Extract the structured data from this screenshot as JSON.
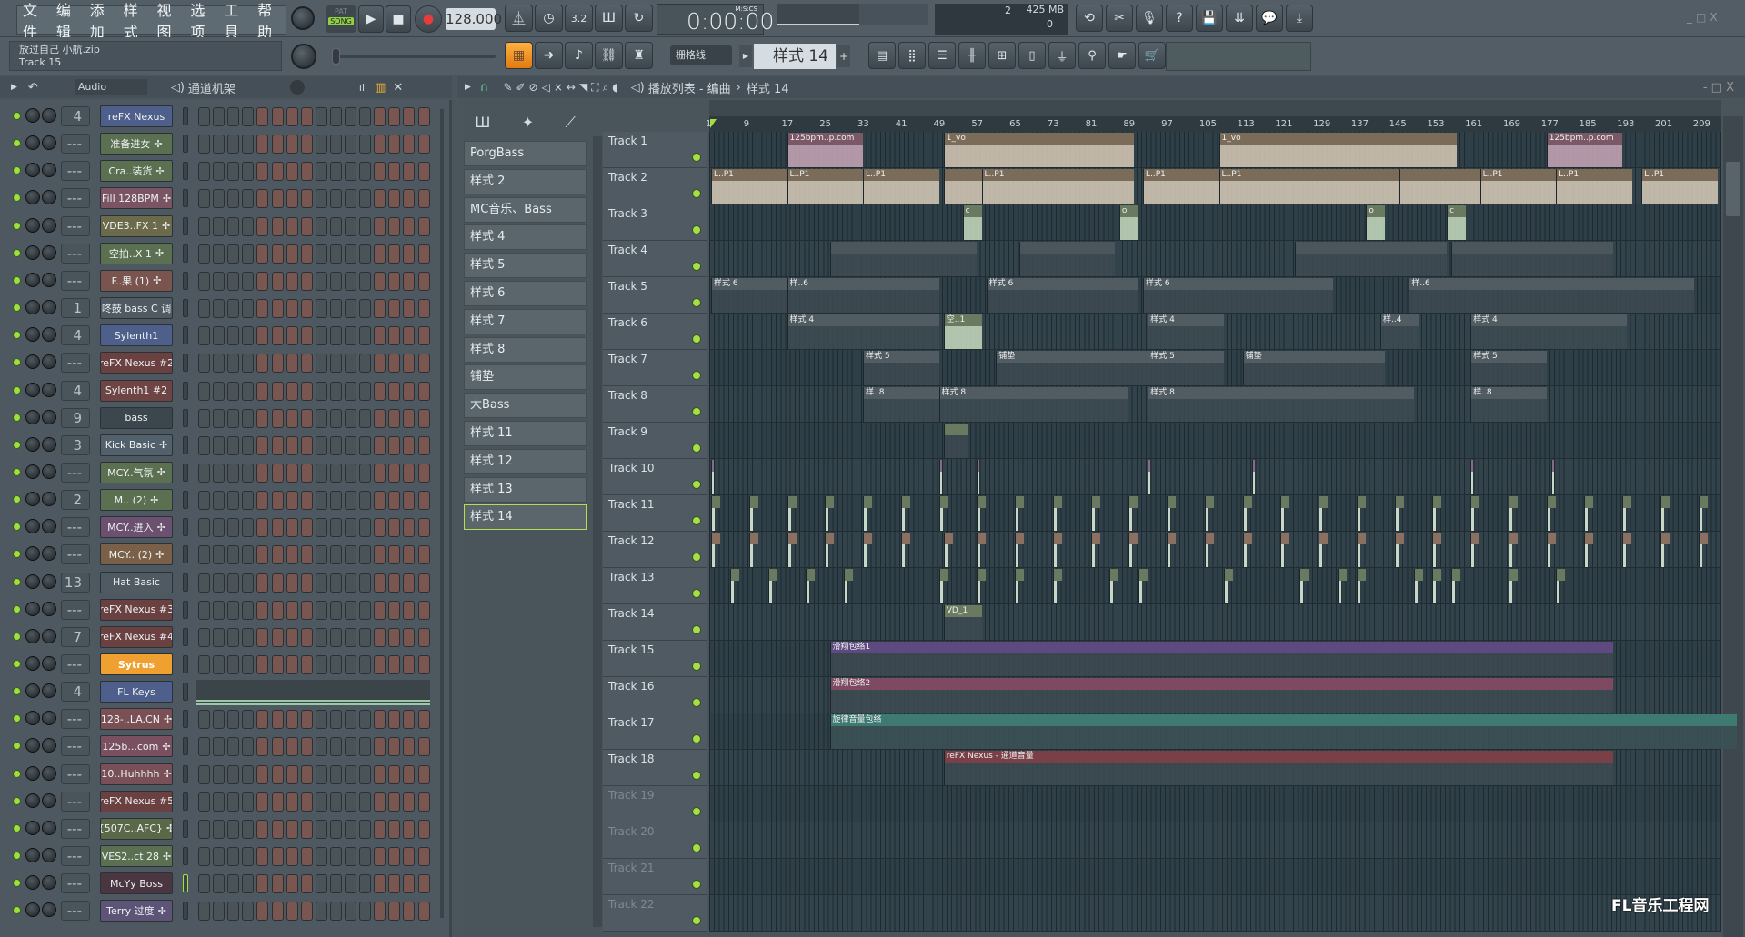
{
  "menu": [
    "文件",
    "编辑",
    "添加",
    "样式",
    "视图",
    "选项",
    "工具",
    "帮助"
  ],
  "transport": {
    "pat": "PAT",
    "song": "SONG",
    "tempo": "128.000",
    "time": "0:00:00",
    "time_label": "M:S:CS",
    "cpu": "2",
    "memory": "425 MB",
    "poly": "0"
  },
  "hint": {
    "line1": "放过自己 小航.zip",
    "line2": "Track 15"
  },
  "snap": "栅格线",
  "pattern_selector": "样式 14",
  "pattern_add": "+",
  "channel_rack": {
    "title": "通道机架",
    "group": "Audio",
    "step_pattern": [
      0,
      0,
      0,
      0,
      1,
      1,
      1,
      1,
      0,
      0,
      0,
      0,
      1,
      1,
      1,
      1
    ],
    "channels": [
      {
        "name": "reFX Nexus",
        "num": "4",
        "color": "#4d5f8a",
        "wave": false
      },
      {
        "name": "准备进女",
        "num": "---",
        "color": "#5b7050",
        "wave": true
      },
      {
        "name": "Cra..装货",
        "num": "---",
        "color": "#5b7050",
        "wave": true
      },
      {
        "name": "Fill 128BPM",
        "num": "---",
        "color": "#7a5463",
        "wave": true
      },
      {
        "name": "VDE3..FX 1",
        "num": "---",
        "color": "#6b6a4a",
        "wave": true
      },
      {
        "name": "空拍..X 1",
        "num": "---",
        "color": "#5b7050",
        "wave": true
      },
      {
        "name": "F..果 (1)",
        "num": "---",
        "color": "#7a5550",
        "wave": true
      },
      {
        "name": "咚鼓 bass C 调",
        "num": "1",
        "color": "#4f5a62",
        "wave": false
      },
      {
        "name": "Sylenth1",
        "num": "4",
        "color": "#4d5f8a",
        "wave": false
      },
      {
        "name": "reFX Nexus #2",
        "num": "---",
        "color": "#6a4040",
        "wave": false
      },
      {
        "name": "Sylenth1 #2",
        "num": "4",
        "color": "#6e4444",
        "wave": false
      },
      {
        "name": "bass",
        "num": "9",
        "color": "#3c464d",
        "wave": false
      },
      {
        "name": "Kick Basic",
        "num": "3",
        "color": "#52606b",
        "wave": true
      },
      {
        "name": "MCY..气氛",
        "num": "---",
        "color": "#5b7050",
        "wave": true
      },
      {
        "name": "M.. (2)",
        "num": "2",
        "color": "#5b7050",
        "wave": true
      },
      {
        "name": "MCY..进入",
        "num": "---",
        "color": "#6b5070",
        "wave": true
      },
      {
        "name": "MCY.. (2)",
        "num": "---",
        "color": "#7a6048",
        "wave": true
      },
      {
        "name": "Hat Basic",
        "num": "13",
        "color": "#4f5a62",
        "wave": false
      },
      {
        "name": "reFX Nexus #3",
        "num": "---",
        "color": "#6a4040",
        "wave": false
      },
      {
        "name": "reFX Nexus #4",
        "num": "7",
        "color": "#6a4040",
        "wave": false
      },
      {
        "name": "Sytrus",
        "num": "---",
        "color": "#f0a030",
        "wave": false,
        "piano": false
      },
      {
        "name": "FL Keys",
        "num": "4",
        "color": "#4d5f8a",
        "wave": false,
        "piano": true
      },
      {
        "name": "128-..LA.CN",
        "num": "---",
        "color": "#7a5055",
        "wave": true
      },
      {
        "name": "125b...com",
        "num": "---",
        "color": "#7a5060",
        "wave": true
      },
      {
        "name": "10..Huhhhh",
        "num": "---",
        "color": "#7a5058",
        "wave": true
      },
      {
        "name": "reFX Nexus #5",
        "num": "---",
        "color": "#6a4040",
        "wave": false
      },
      {
        "name": "{507C..AFC}",
        "num": "---",
        "color": "#5a6848",
        "wave": true
      },
      {
        "name": "VES2..ct 28",
        "num": "---",
        "color": "#5a7050",
        "wave": true
      },
      {
        "name": "McYy Boss",
        "num": "---",
        "color": "#4a3640",
        "wave": false
      },
      {
        "name": "Terry 过度",
        "num": "---",
        "color": "#5e5478",
        "wave": true
      }
    ]
  },
  "playlist": {
    "title": "播放列表 - 编曲",
    "crumb": "样式 14",
    "patterns": [
      "PorgBass",
      "样式 2",
      "MC音乐、Bass",
      "样式 4",
      "样式 5",
      "样式 6",
      "样式 7",
      "样式 8",
      "铺垫",
      "大Bass",
      "样式 11",
      "样式 12",
      "样式 13",
      "样式 14"
    ],
    "selected_pattern": "样式 14",
    "ruler": [
      1,
      9,
      17,
      25,
      33,
      41,
      49,
      57,
      65,
      73,
      81,
      89,
      97,
      105,
      113,
      121,
      129,
      137,
      145,
      153,
      161,
      169,
      177,
      185,
      193,
      201,
      209
    ],
    "tracks": [
      "Track 1",
      "Track 2",
      "Track 3",
      "Track 4",
      "Track 5",
      "Track 6",
      "Track 7",
      "Track 8",
      "Track 9",
      "Track 10",
      "Track 11",
      "Track 12",
      "Track 13",
      "Track 14",
      "Track 15",
      "Track 16",
      "Track 17",
      "Track 18",
      "Track 19",
      "Track 20",
      "Track 21",
      "Track 22"
    ],
    "clips": [
      {
        "t": 1,
        "s": 17,
        "l": 16,
        "n": "125bpm..p.com",
        "c": "#7a5866",
        "b": "#c9a8b8"
      },
      {
        "t": 1,
        "s": 50,
        "l": 40,
        "n": "1_vo",
        "c": "#7a6c58",
        "b": "#d8cbb8"
      },
      {
        "t": 1,
        "s": 108,
        "l": 50,
        "n": "1_vo",
        "c": "#7a6c58",
        "b": "#d8cbb8"
      },
      {
        "t": 1,
        "s": 177,
        "l": 16,
        "n": "125bpm..p.com",
        "c": "#7a5866",
        "b": "#c9a8b8"
      },
      {
        "t": 2,
        "s": 1,
        "l": 16,
        "n": "L..P1",
        "c": "#7a6c58",
        "b": "#d8cbb8"
      },
      {
        "t": 2,
        "s": 17,
        "l": 16,
        "n": "L..P1",
        "c": "#7a6c58",
        "b": "#d8cbb8"
      },
      {
        "t": 2,
        "s": 33,
        "l": 16,
        "n": "L..P1",
        "c": "#7a6c58",
        "b": "#d8cbb8"
      },
      {
        "t": 2,
        "s": 50,
        "l": 8,
        "n": "",
        "c": "#7a6c58",
        "b": "#d8cbb8"
      },
      {
        "t": 2,
        "s": 58,
        "l": 32,
        "n": "L..P1",
        "c": "#7a6c58",
        "b": "#d8cbb8"
      },
      {
        "t": 2,
        "s": 92,
        "l": 16,
        "n": "L..P1",
        "c": "#7a6c58",
        "b": "#d8cbb8"
      },
      {
        "t": 2,
        "s": 108,
        "l": 38,
        "n": "L..P1",
        "c": "#7a6c58",
        "b": "#d8cbb8"
      },
      {
        "t": 2,
        "s": 146,
        "l": 17,
        "n": "",
        "c": "#7a6c58",
        "b": "#d8cbb8"
      },
      {
        "t": 2,
        "s": 163,
        "l": 16,
        "n": "L..P1",
        "c": "#7a6c58",
        "b": "#d8cbb8"
      },
      {
        "t": 2,
        "s": 179,
        "l": 16,
        "n": "L..P1",
        "c": "#7a6c58",
        "b": "#d8cbb8"
      },
      {
        "t": 2,
        "s": 197,
        "l": 16,
        "n": "L..P1",
        "c": "#7a6c58",
        "b": "#d8cbb8"
      },
      {
        "t": 3,
        "s": 54,
        "l": 4,
        "n": "c",
        "c": "#6a7a60",
        "b": "#c8dcc0"
      },
      {
        "t": 3,
        "s": 87,
        "l": 4,
        "n": "o",
        "c": "#6a7a60",
        "b": "#c8dcc0"
      },
      {
        "t": 3,
        "s": 139,
        "l": 4,
        "n": "o",
        "c": "#6a7a60",
        "b": "#c8dcc0"
      },
      {
        "t": 3,
        "s": 156,
        "l": 4,
        "n": "c",
        "c": "#6a7a60",
        "b": "#c8dcc0"
      },
      {
        "t": 4,
        "s": 26,
        "l": 31,
        "n": "",
        "c": "#4a555c",
        "b": "#3e4a52"
      },
      {
        "t": 4,
        "s": 66,
        "l": 20,
        "n": "",
        "c": "#4a555c",
        "b": "#3e4a52"
      },
      {
        "t": 4,
        "s": 124,
        "l": 32,
        "n": "",
        "c": "#4a555c",
        "b": "#3e4a52"
      },
      {
        "t": 4,
        "s": 157,
        "l": 34,
        "n": "",
        "c": "#4a555c",
        "b": "#3e4a52"
      },
      {
        "t": 5,
        "s": 1,
        "l": 16,
        "n": "样式 6",
        "c": "#505b62",
        "b": "#3d4a52"
      },
      {
        "t": 5,
        "s": 17,
        "l": 32,
        "n": "样..6",
        "c": "#505b62",
        "b": "#3d4a52"
      },
      {
        "t": 5,
        "s": 59,
        "l": 32,
        "n": "样式 6",
        "c": "#505b62",
        "b": "#3d4a52"
      },
      {
        "t": 5,
        "s": 92,
        "l": 40,
        "n": "样式 6",
        "c": "#505b62",
        "b": "#3d4a52"
      },
      {
        "t": 5,
        "s": 148,
        "l": 60,
        "n": "样..6",
        "c": "#505b62",
        "b": "#3d4a52"
      },
      {
        "t": 6,
        "s": 17,
        "l": 32,
        "n": "样式 4",
        "c": "#505b62",
        "b": "#3d4a52"
      },
      {
        "t": 6,
        "s": 50,
        "l": 8,
        "n": "空..1",
        "c": "#6a7a60",
        "b": "#c8dcc0"
      },
      {
        "t": 6,
        "s": 93,
        "l": 16,
        "n": "样式 4",
        "c": "#505b62",
        "b": "#3d4a52"
      },
      {
        "t": 6,
        "s": 142,
        "l": 8,
        "n": "样..4",
        "c": "#505b62",
        "b": "#3d4a52"
      },
      {
        "t": 6,
        "s": 161,
        "l": 33,
        "n": "样式 4",
        "c": "#505b62",
        "b": "#3d4a52"
      },
      {
        "t": 7,
        "s": 33,
        "l": 16,
        "n": "样式 5",
        "c": "#505b62",
        "b": "#3d4a52"
      },
      {
        "t": 7,
        "s": 61,
        "l": 32,
        "n": "铺垫",
        "c": "#505b62",
        "b": "#3d4a52"
      },
      {
        "t": 7,
        "s": 93,
        "l": 16,
        "n": "样式 5",
        "c": "#505b62",
        "b": "#3d4a52"
      },
      {
        "t": 7,
        "s": 113,
        "l": 30,
        "n": "铺垫",
        "c": "#505b62",
        "b": "#3d4a52"
      },
      {
        "t": 7,
        "s": 161,
        "l": 16,
        "n": "样式 5",
        "c": "#505b62",
        "b": "#3d4a52"
      },
      {
        "t": 8,
        "s": 33,
        "l": 16,
        "n": "样..8",
        "c": "#505b62",
        "b": "#3d4a52"
      },
      {
        "t": 8,
        "s": 49,
        "l": 40,
        "n": "样式 8",
        "c": "#505b62",
        "b": "#3d4a52"
      },
      {
        "t": 8,
        "s": 93,
        "l": 56,
        "n": "样式 8",
        "c": "#505b62",
        "b": "#3d4a52"
      },
      {
        "t": 8,
        "s": 161,
        "l": 16,
        "n": "样..8",
        "c": "#505b62",
        "b": "#3d4a52"
      },
      {
        "t": 9,
        "s": 50,
        "l": 5,
        "n": "",
        "c": "#6a7a60",
        "b": "#3d4a52"
      },
      {
        "t": 14,
        "s": 50,
        "l": 8,
        "n": "VD_1",
        "c": "#6a7a60",
        "b": "#3d4a52"
      },
      {
        "t": 15,
        "s": 26,
        "l": 165,
        "n": "滑翔包络1",
        "c": "#5e4a80",
        "b": "#3d4a52"
      },
      {
        "t": 16,
        "s": 26,
        "l": 165,
        "n": "滑翔包络2",
        "c": "#7d4a62",
        "b": "#3d4a52"
      },
      {
        "t": 17,
        "s": 26,
        "l": 191,
        "n": "旋律音量包络",
        "c": "#3f7a72",
        "b": "#3b5256"
      },
      {
        "t": 18,
        "s": 50,
        "l": 141,
        "n": "reFX Nexus - 通道音量",
        "c": "#7a4048",
        "b": "#3d4a52"
      }
    ],
    "hits": [
      {
        "t": 10,
        "bars": [
          1,
          49,
          57,
          93,
          115,
          161,
          178
        ],
        "c": "#8a6a8a"
      },
      {
        "t": 11,
        "bars": [
          1,
          9,
          17,
          25,
          33,
          41,
          49,
          57,
          65,
          73,
          81,
          89,
          97,
          105,
          113,
          121,
          129,
          137,
          145,
          153,
          161,
          169,
          177,
          185,
          193,
          201,
          209
        ],
        "c": "#6a7a60"
      },
      {
        "t": 12,
        "bars": [
          1,
          9,
          17,
          25,
          33,
          41,
          50,
          57,
          65,
          73,
          81,
          89,
          97,
          105,
          113,
          121,
          129,
          137,
          145,
          153,
          161,
          169,
          177,
          185,
          193,
          201,
          209
        ],
        "c": "#8a7060"
      },
      {
        "t": 13,
        "bars": [
          5,
          13,
          21,
          29,
          49,
          57,
          65,
          73,
          85,
          91,
          109,
          125,
          133,
          137,
          149,
          153,
          157,
          169,
          179
        ],
        "c": "#6a7a60"
      }
    ]
  },
  "watermark": "FL音乐工程网"
}
